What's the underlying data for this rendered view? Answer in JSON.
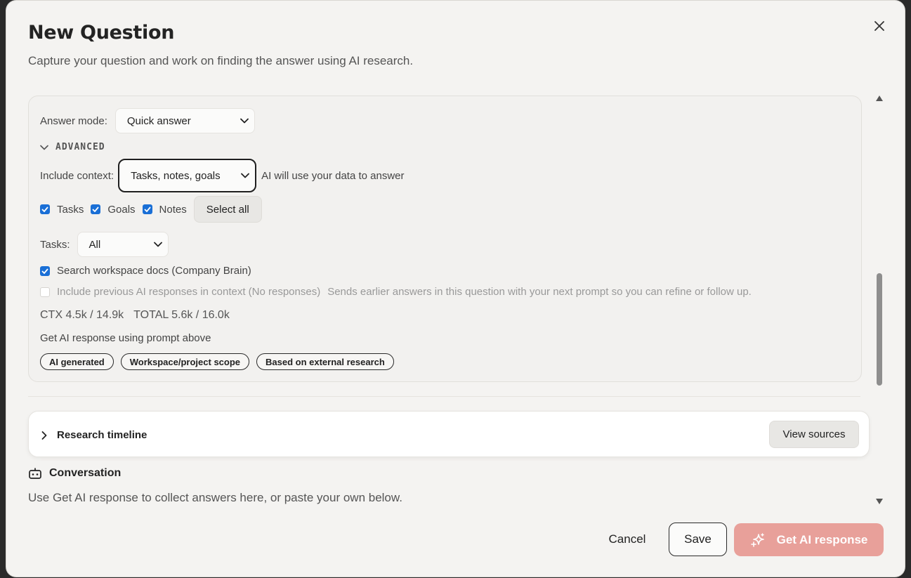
{
  "dialog": {
    "title": "New Question",
    "subtitle": "Capture your question and work on finding the answer using AI research."
  },
  "settings": {
    "answer_mode_label": "Answer mode:",
    "answer_mode_value": "Quick answer",
    "advanced_label": "ADVANCED",
    "include_context_label": "Include context:",
    "include_context_value": "Tasks, notes, goals",
    "include_context_hint": "AI will use your data to answer",
    "checkboxes": [
      {
        "label": "Tasks",
        "checked": true
      },
      {
        "label": "Goals",
        "checked": true
      },
      {
        "label": "Notes",
        "checked": true
      }
    ],
    "select_all_label": "Select all",
    "tasks_label": "Tasks:",
    "tasks_value": "All",
    "search_docs_label": "Search workspace docs (Company Brain)",
    "search_docs_checked": true,
    "include_prev_label": "Include previous AI responses in context (No responses)",
    "include_prev_checked": false,
    "include_prev_hint": "Sends earlier answers in this question with your next prompt so you can refine or follow up.",
    "ctx_stat": "CTX 4.5k / 14.9k",
    "total_stat": "TOTAL 5.6k / 16.0k",
    "prompt_hint": "Get AI response using prompt above",
    "chips": [
      "AI generated",
      "Workspace/project scope",
      "Based on external research"
    ]
  },
  "timeline": {
    "label": "Research timeline",
    "view_sources_label": "View sources"
  },
  "conversation": {
    "title": "Conversation",
    "description": "Use Get AI response to collect answers here, or paste your own below."
  },
  "footer": {
    "cancel_label": "Cancel",
    "save_label": "Save",
    "get_ai_label": "Get AI response"
  },
  "colors": {
    "primary_disabled": "#e8a09a",
    "checkbox": "#1a6fd6"
  }
}
